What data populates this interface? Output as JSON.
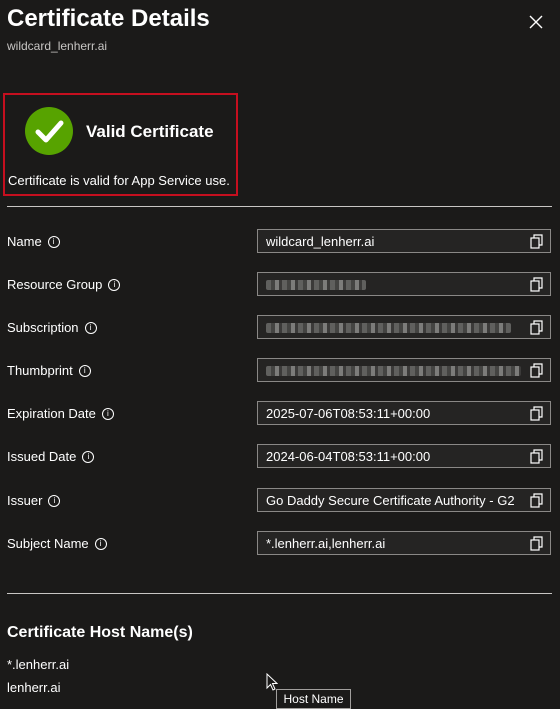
{
  "header": {
    "title": "Certificate Details",
    "subtitle": "wildcard_lenherr.ai"
  },
  "status": {
    "title": "Valid Certificate",
    "message": "Certificate is valid for App Service use.",
    "color": "#57a300"
  },
  "fields": [
    {
      "label": "Name",
      "value": "wildcard_lenherr.ai"
    },
    {
      "label": "Resource Group",
      "value": ""
    },
    {
      "label": "Subscription",
      "value": ""
    },
    {
      "label": "Thumbprint",
      "value": ""
    },
    {
      "label": "Expiration Date",
      "value": "2025-07-06T08:53:11+00:00"
    },
    {
      "label": "Issued Date",
      "value": "2024-06-04T08:53:11+00:00"
    },
    {
      "label": "Issuer",
      "value": "Go Daddy Secure Certificate Authority - G2"
    },
    {
      "label": "Subject Name",
      "value": "*.lenherr.ai,lenherr.ai"
    }
  ],
  "hostnames": {
    "title": "Certificate Host Name(s)",
    "items": [
      "*.lenherr.ai",
      "lenherr.ai"
    ]
  },
  "tooltip": "Host Name",
  "icons": {
    "close": "close-icon",
    "check": "checkmark-icon",
    "info": "info-icon",
    "copy": "copy-icon"
  }
}
